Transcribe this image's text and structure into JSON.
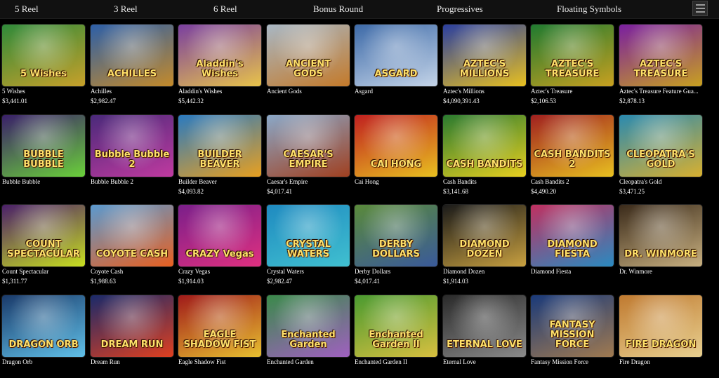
{
  "nav": {
    "items": [
      "5 Reel",
      "3 Reel",
      "6 Reel",
      "Bonus Round",
      "Progressives",
      "Floating Symbols"
    ],
    "view_toggle_icon": "list-view-icon"
  },
  "games": [
    {
      "name": "5 Wishes",
      "jackpot": "$3,441.01",
      "logo": "5 Wishes",
      "bg1": "#2f8a3a",
      "bg2": "#c7a02a"
    },
    {
      "name": "Achilles",
      "jackpot": "$2,982.47",
      "logo": "ACHILLES",
      "bg1": "#2c5fa8",
      "bg2": "#c48a2a"
    },
    {
      "name": "Aladdin's Wishes",
      "jackpot": "$5,442.32",
      "logo": "Aladdin's Wishes",
      "bg1": "#7a3fa0",
      "bg2": "#e8c34a"
    },
    {
      "name": "Ancient Gods",
      "jackpot": "",
      "logo": "ANCIENT GODS",
      "bg1": "#a8b7c4",
      "bg2": "#c47a2a"
    },
    {
      "name": "Asgard",
      "jackpot": "",
      "logo": "ASGARD",
      "bg1": "#3d6aa8",
      "bg2": "#c4d4e8"
    },
    {
      "name": "Aztec's Millions",
      "jackpot": "$4,090,391.43",
      "logo": "AZTEC'S MILLIONS",
      "bg1": "#2a3fa0",
      "bg2": "#e8c020"
    },
    {
      "name": "Aztec's Treasure",
      "jackpot": "$2,106.53",
      "logo": "AZTEC'S TREASURE",
      "bg1": "#1f7a30",
      "bg2": "#c8a020"
    },
    {
      "name": "Aztec's Treasure Feature Gua...",
      "jackpot": "$2,878.13",
      "logo": "AZTEC'S TREASURE",
      "bg1": "#7a1fa0",
      "bg2": "#c8a020"
    },
    {
      "name": "Bubble Bubble",
      "jackpot": "",
      "logo": "BUBBLE BUBBLE",
      "bg1": "#3a1f6a",
      "bg2": "#6ad03a"
    },
    {
      "name": "Bubble Bubble 2",
      "jackpot": "",
      "logo": "Bubble Bubble 2",
      "bg1": "#4a2a7a",
      "bg2": "#c03aa0"
    },
    {
      "name": "Builder Beaver",
      "jackpot": "$4,093.82",
      "logo": "BUILDER BEAVER",
      "bg1": "#2a7ac0",
      "bg2": "#e8a020"
    },
    {
      "name": "Caesar's Empire",
      "jackpot": "$4,017.41",
      "logo": "CAESAR'S EMPIRE",
      "bg1": "#8aa8c8",
      "bg2": "#a04020"
    },
    {
      "name": "Cai Hong",
      "jackpot": "",
      "logo": "CAI HONG",
      "bg1": "#c02020",
      "bg2": "#e8c020"
    },
    {
      "name": "Cash Bandits",
      "jackpot": "$3,141.68",
      "logo": "CASH BANDITS",
      "bg1": "#2a7a30",
      "bg2": "#e8d020"
    },
    {
      "name": "Cash Bandits 2",
      "jackpot": "$4,490.20",
      "logo": "CASH BANDITS 2",
      "bg1": "#a02020",
      "bg2": "#e8c020"
    },
    {
      "name": "Cleopatra's Gold",
      "jackpot": "$3,471.25",
      "logo": "CLEOPATRA'S GOLD",
      "bg1": "#2a8ab0",
      "bg2": "#d8b030"
    },
    {
      "name": "Count Spectacular",
      "jackpot": "$1,311.77",
      "logo": "COUNT SPECTACULAR",
      "bg1": "#4a1f6a",
      "bg2": "#c8e020"
    },
    {
      "name": "Coyote Cash",
      "jackpot": "$1,988.63",
      "logo": "COYOTE CASH",
      "bg1": "#5a9ad0",
      "bg2": "#e86020"
    },
    {
      "name": "Crazy Vegas",
      "jackpot": "$1,914.03",
      "logo": "CRAZY Vegas",
      "bg1": "#7a1f8a",
      "bg2": "#e03080"
    },
    {
      "name": "Crystal Waters",
      "jackpot": "$2,982.47",
      "logo": "CRYSTAL WATERS",
      "bg1": "#1f8ac0",
      "bg2": "#40c0d0"
    },
    {
      "name": "Derby Dollars",
      "jackpot": "$4,017.41",
      "logo": "DERBY DOLLARS",
      "bg1": "#5a8a3a",
      "bg2": "#3a5a9a"
    },
    {
      "name": "Diamond Dozen",
      "jackpot": "$1,914.03",
      "logo": "DIAMOND DOZEN",
      "bg1": "#1a1a1a",
      "bg2": "#c8a040"
    },
    {
      "name": "Diamond Fiesta",
      "jackpot": "",
      "logo": "DIAMOND FIESTA",
      "bg1": "#c03060",
      "bg2": "#2a8ac0"
    },
    {
      "name": "Dr. Winmore",
      "jackpot": "",
      "logo": "DR. WINMORE",
      "bg1": "#3a2a1a",
      "bg2": "#c8b080"
    },
    {
      "name": "Dragon Orb",
      "jackpot": "",
      "logo": "DRAGON ORB",
      "bg1": "#1a3a6a",
      "bg2": "#60c0e8"
    },
    {
      "name": "Dream Run",
      "jackpot": "",
      "logo": "DREAM RUN",
      "bg1": "#1a2a6a",
      "bg2": "#e04020"
    },
    {
      "name": "Eagle Shadow Fist",
      "jackpot": "",
      "logo": "EAGLE SHADOW FIST",
      "bg1": "#a01a1a",
      "bg2": "#e8c030"
    },
    {
      "name": "Enchanted Garden",
      "jackpot": "",
      "logo": "Enchanted Garden",
      "bg1": "#3a8a4a",
      "bg2": "#a060c0"
    },
    {
      "name": "Enchanted Garden II",
      "jackpot": "",
      "logo": "Enchanted Garden II",
      "bg1": "#4a9a30",
      "bg2": "#d8c040"
    },
    {
      "name": "Eternal Love",
      "jackpot": "",
      "logo": "ETERNAL LOVE",
      "bg1": "#2a2a2a",
      "bg2": "#8a8a8a"
    },
    {
      "name": "Fantasy Mission Force",
      "jackpot": "",
      "logo": "FANTASY MISSION FORCE",
      "bg1": "#1a3a7a",
      "bg2": "#a07a50"
    },
    {
      "name": "Fire Dragon",
      "jackpot": "",
      "logo": "FIRE DRAGON",
      "bg1": "#c07a30",
      "bg2": "#e8d090"
    }
  ]
}
